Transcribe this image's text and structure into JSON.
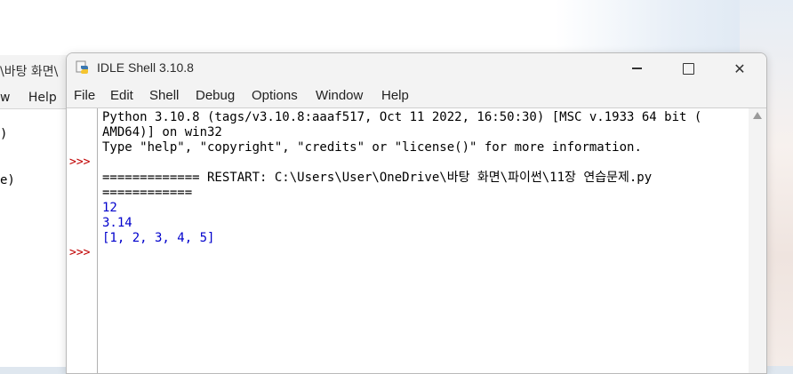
{
  "background_window": {
    "title": "\\바탕 화면\\",
    "menu": [
      "w",
      "Help"
    ],
    "code_lines": [
      ")",
      "e)"
    ]
  },
  "window": {
    "title": "IDLE Shell 3.10.8",
    "controls": {
      "minimize": "–",
      "maximize": "□",
      "close": "✕"
    }
  },
  "menu": [
    "File",
    "Edit",
    "Shell",
    "Debug",
    "Options",
    "Window",
    "Help"
  ],
  "shell": {
    "prompt": ">>>",
    "banner_line1": "Python 3.10.8 (tags/v3.10.8:aaaf517, Oct 11 2022, 16:50:30) [MSC v.1933 64 bit (",
    "banner_line2": "AMD64)] on win32",
    "banner_line3": "Type \"help\", \"copyright\", \"credits\" or \"license()\" for more information.",
    "restart_line1": "============= RESTART: C:\\Users\\User\\OneDrive\\바탕 화면\\파이썬\\11장 연습문제.py",
    "restart_line2": "============",
    "output": [
      "12",
      "3.14",
      "[1, 2, 3, 4, 5]"
    ]
  },
  "colors": {
    "prompt": "#c00000",
    "stdout": "#0000cc",
    "text": "#000000"
  }
}
